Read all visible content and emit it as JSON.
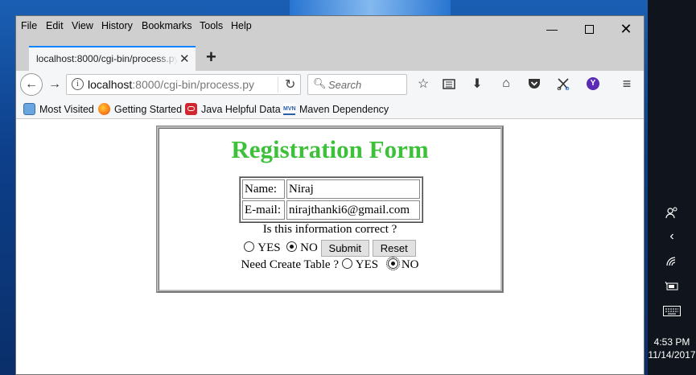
{
  "menu": {
    "file": "File",
    "edit": "Edit",
    "view": "View",
    "history": "History",
    "bookmarks": "Bookmarks",
    "tools": "Tools",
    "help": "Help"
  },
  "tab": {
    "title": "localhost:8000/cgi-bin/process.py"
  },
  "urlbar": {
    "host": "localhost",
    "rest": ":8000/cgi-bin/process.py"
  },
  "search": {
    "placeholder": "Search"
  },
  "bookmarks": [
    {
      "label": "Most Visited",
      "icon": "most-visited-icon"
    },
    {
      "label": "Getting Started",
      "icon": "firefox-icon"
    },
    {
      "label": "Java Helpful Data",
      "icon": "oracle-icon"
    },
    {
      "label": "Maven Dependency",
      "icon": "maven-icon"
    }
  ],
  "form": {
    "title": "Registration Form",
    "name_label": "Name:",
    "name_value": "Niraj",
    "email_label": "E-mail:",
    "email_value": "nirajthanki6@gmail.com",
    "question": "Is this information correct ?",
    "yes": "YES",
    "no": "NO",
    "correct_selected": "NO",
    "submit": "Submit",
    "reset": "Reset",
    "table_question": "Need Create Table ?",
    "table_yes": "YES",
    "table_no": "NO",
    "table_selected": "NO"
  },
  "taskbar": {
    "time": "4:53 PM",
    "date": "11/14/2017"
  },
  "colors": {
    "title_green": "#3ec13a",
    "accent": "#0a84ff",
    "profile": "#5b2bb5"
  }
}
